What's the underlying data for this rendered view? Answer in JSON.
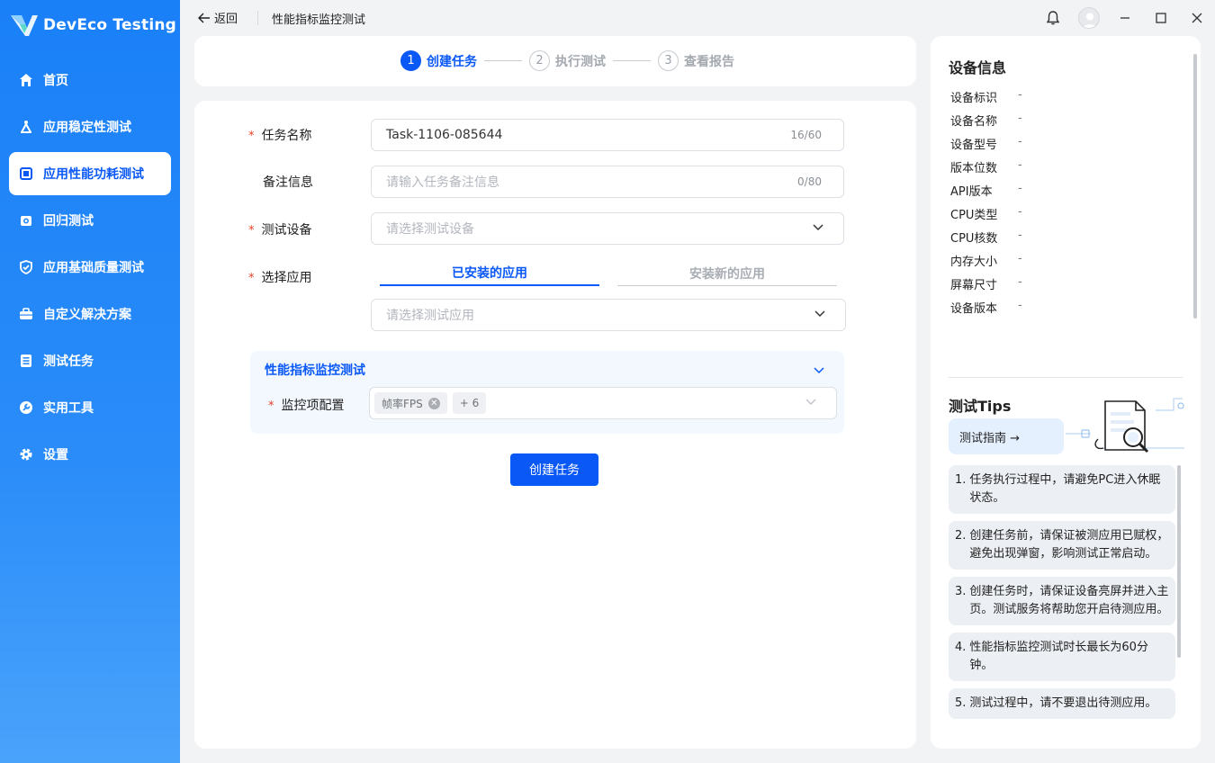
{
  "app": {
    "name": "DevEco Testing"
  },
  "sidebar": {
    "items": [
      {
        "label": "首页",
        "icon": "home-icon"
      },
      {
        "label": "应用稳定性测试",
        "icon": "stability-icon"
      },
      {
        "label": "应用性能功耗测试",
        "icon": "performance-icon",
        "active": true
      },
      {
        "label": "回归测试",
        "icon": "regression-icon"
      },
      {
        "label": "应用基础质量测试",
        "icon": "quality-check-icon"
      },
      {
        "label": "自定义解决方案",
        "icon": "toolbox-icon"
      },
      {
        "label": "测试任务",
        "icon": "task-list-icon"
      },
      {
        "label": "实用工具",
        "icon": "tools-icon"
      },
      {
        "label": "设置",
        "icon": "settings-icon"
      }
    ]
  },
  "topbar": {
    "back_label": "返回",
    "title": "性能指标监控测试"
  },
  "steps": [
    {
      "num": "1",
      "label": "创建任务",
      "active": true
    },
    {
      "num": "2",
      "label": "执行测试",
      "active": false
    },
    {
      "num": "3",
      "label": "查看报告",
      "active": false
    }
  ],
  "form": {
    "task_name": {
      "label": "任务名称",
      "value": "Task-1106-085644",
      "count": "16/60"
    },
    "remark": {
      "label": "备注信息",
      "placeholder": "请输入任务备注信息",
      "count": "0/80"
    },
    "device": {
      "label": "测试设备",
      "placeholder": "请选择测试设备"
    },
    "app": {
      "label": "选择应用",
      "tabs": [
        "已安装的应用",
        "安装新的应用"
      ],
      "placeholder": "请选择测试应用"
    },
    "perf_panel": {
      "title": "性能指标监控测试",
      "monitor_label": "监控项配置",
      "chips": [
        "帧率FPS",
        "+ 6"
      ]
    },
    "submit_label": "创建任务"
  },
  "device_info": {
    "title": "设备信息",
    "rows": [
      {
        "key": "设备标识",
        "value": "-"
      },
      {
        "key": "设备名称",
        "value": "-"
      },
      {
        "key": "设备型号",
        "value": "-"
      },
      {
        "key": "版本位数",
        "value": "-"
      },
      {
        "key": "API版本",
        "value": "-"
      },
      {
        "key": "CPU类型",
        "value": "-"
      },
      {
        "key": "CPU核数",
        "value": "-"
      },
      {
        "key": "内存大小",
        "value": "-"
      },
      {
        "key": "屏幕尺寸",
        "value": "-"
      },
      {
        "key": "设备版本",
        "value": "-"
      }
    ]
  },
  "tips": {
    "title": "测试Tips",
    "guide_label": "测试指南 →",
    "items": [
      {
        "num": "1.",
        "text": "任务执行过程中，请避免PC进入休眠状态。"
      },
      {
        "num": "2.",
        "text": "创建任务前，请保证被测应用已赋权，避免出现弹窗，影响测试正常启动。"
      },
      {
        "num": "3.",
        "text": "创建任务时，请保证设备亮屏并进入主页。测试服务将帮助您开启待测应用。"
      },
      {
        "num": "4.",
        "text": "性能指标监控测试时长最长为60分钟。"
      },
      {
        "num": "5.",
        "text": "测试过程中，请不要退出待测应用。"
      }
    ]
  },
  "colors": {
    "primary": "#0a59f7",
    "sidebar": "#1a80f8",
    "required": "#e84026"
  }
}
